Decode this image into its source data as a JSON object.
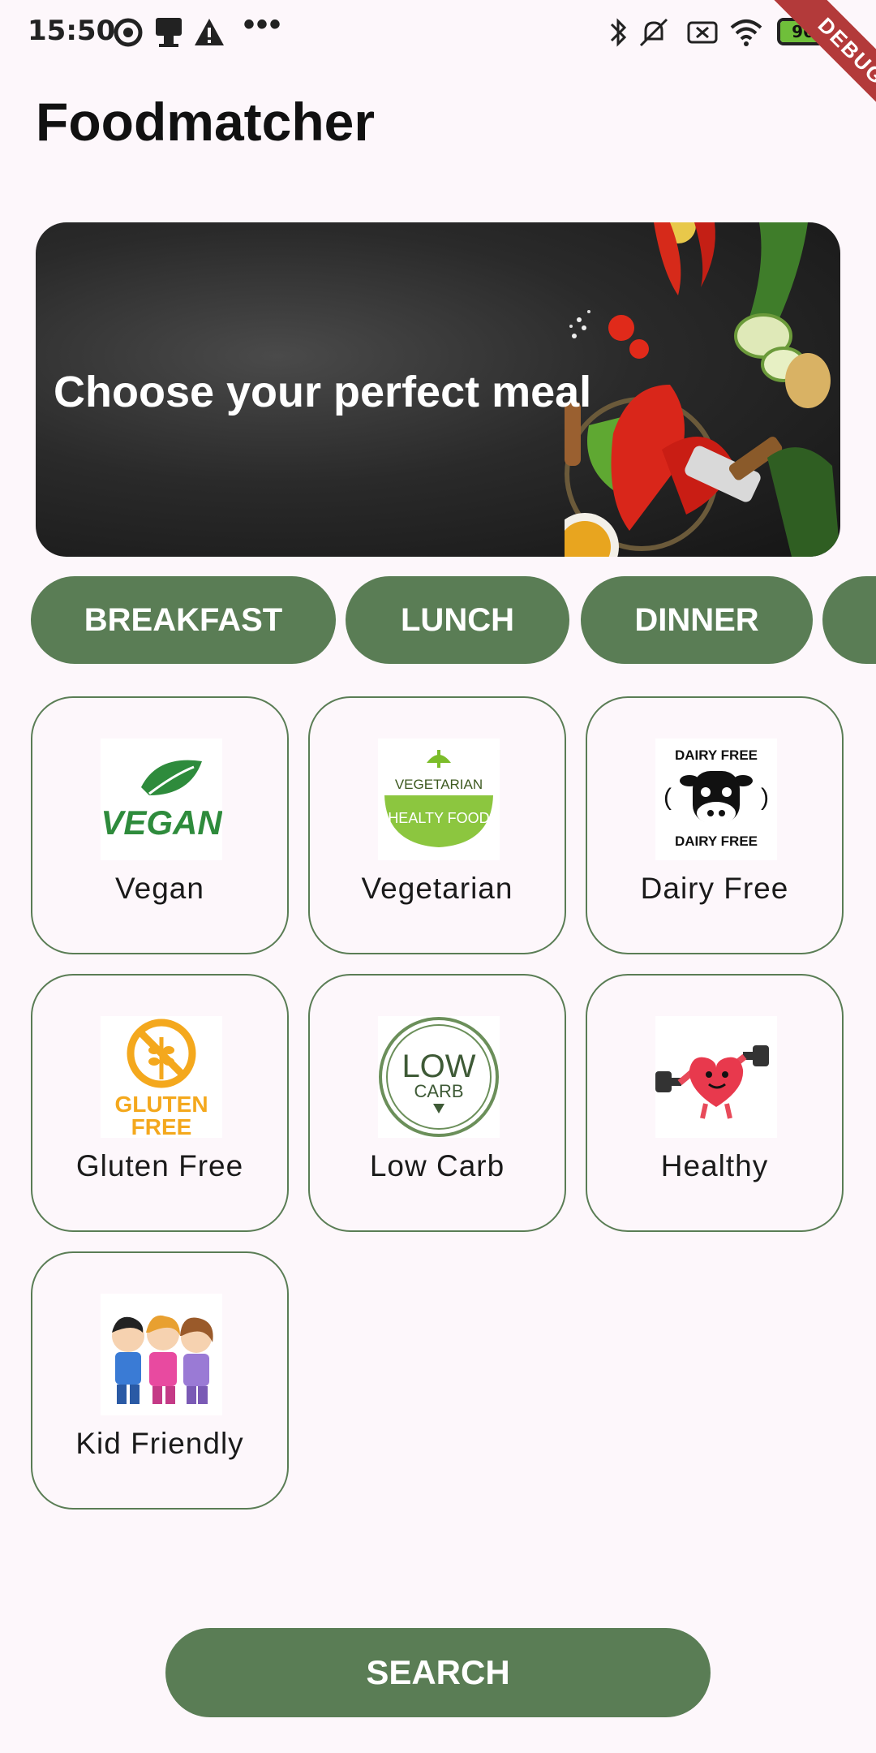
{
  "status_bar": {
    "time": "15:50",
    "dots": "•••",
    "battery_level": "96",
    "debug_label": "DEBUG"
  },
  "app": {
    "title": "Foodmatcher"
  },
  "hero": {
    "headline": "Choose your perfect meal"
  },
  "meal_tabs": [
    {
      "label": "BREAKFAST"
    },
    {
      "label": "LUNCH"
    },
    {
      "label": "DINNER"
    },
    {
      "label": ""
    }
  ],
  "diet_options": [
    {
      "label": "Vegan",
      "icon": "vegan-icon"
    },
    {
      "label": "Vegetarian",
      "icon": "vegetarian-icon"
    },
    {
      "label": "Dairy Free",
      "icon": "dairy-free-icon"
    },
    {
      "label": "Gluten Free",
      "icon": "gluten-free-icon"
    },
    {
      "label": "Low Carb",
      "icon": "low-carb-icon"
    },
    {
      "label": "Healthy",
      "icon": "healthy-icon"
    },
    {
      "label": "Kid Friendly",
      "icon": "kid-friendly-icon"
    }
  ],
  "icon_text": {
    "vegan": "VEGAN",
    "vegetarian_top": "VEGETARIAN",
    "vegetarian_bottom": "HEALTY FOOD",
    "dairy_top": "DAIRY FREE",
    "dairy_bottom": "DAIRY FREE",
    "gluten_1": "GLUTEN",
    "gluten_2": "FREE",
    "low": "LOW",
    "carb": "CARB"
  },
  "search_button": {
    "label": "SEARCH"
  },
  "colors": {
    "accent": "#5a7d55",
    "background": "#fdf7fb"
  }
}
